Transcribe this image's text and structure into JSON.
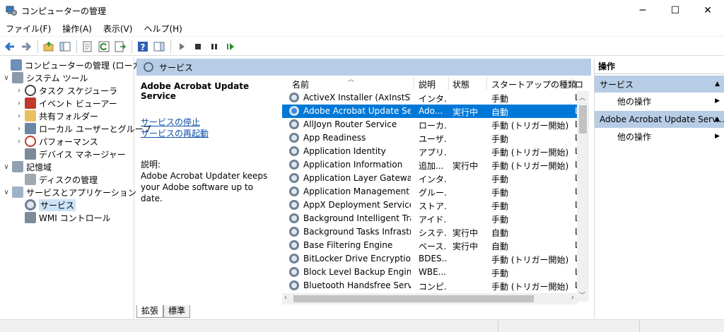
{
  "window": {
    "title": "コンピューターの管理",
    "minimize": "─",
    "maximize": "☐",
    "close": "✕"
  },
  "menu": [
    "ファイル(F)",
    "操作(A)",
    "表示(V)",
    "ヘルプ(H)"
  ],
  "toolbar": {
    "icons": [
      "back-icon",
      "forward-icon",
      "up-folder-icon",
      "show-hide-tree-icon",
      "properties-icon",
      "refresh-icon",
      "export-list-icon",
      "help-icon",
      "show-hide-action-pane-icon",
      "start-service-icon",
      "stop-service-icon",
      "pause-service-icon",
      "restart-service-icon"
    ]
  },
  "tree": [
    {
      "label": "コンピューターの管理 (ローカル)",
      "chevron": ""
    },
    {
      "label": "システム ツール",
      "chevron": "∨"
    },
    {
      "label": "タスク スケジューラ",
      "chevron": "›"
    },
    {
      "label": "イベント ビューアー",
      "chevron": "›"
    },
    {
      "label": "共有フォルダー",
      "chevron": "›"
    },
    {
      "label": "ローカル ユーザーとグループ",
      "chevron": "›"
    },
    {
      "label": "パフォーマンス",
      "chevron": "›"
    },
    {
      "label": "デバイス マネージャー",
      "chevron": ""
    },
    {
      "label": "記憶域",
      "chevron": "∨"
    },
    {
      "label": "ディスクの管理",
      "chevron": ""
    },
    {
      "label": "サービスとアプリケーション",
      "chevron": "∨"
    },
    {
      "label": "サービス",
      "chevron": ""
    },
    {
      "label": "WMI コントロール",
      "chevron": ""
    }
  ],
  "services_pane": {
    "header": "サービス",
    "detail": {
      "name": "Adobe Acrobat Update Service",
      "stop_link": "サービスの停止",
      "restart_link": "サービスの再起動",
      "desc_label": "説明:",
      "desc": "Adobe Acrobat Updater keeps your Adobe software up to date."
    },
    "columns": {
      "name": "名前",
      "desc": "説明",
      "status": "状態",
      "startup": "スタートアップの種類",
      "logon": "ロ"
    },
    "rows": [
      {
        "name": "ActiveX Installer (AxInstSV)",
        "desc": "インタ...",
        "status": "",
        "startup": "手動",
        "logon": "L"
      },
      {
        "name": "Adobe Acrobat Update Serv...",
        "desc": "Ado...",
        "status": "実行中",
        "startup": "自動",
        "logon": "L"
      },
      {
        "name": "AllJoyn Router Service",
        "desc": "ローカ...",
        "status": "",
        "startup": "手動 (トリガー開始)",
        "logon": "L"
      },
      {
        "name": "App Readiness",
        "desc": "ユーザ...",
        "status": "",
        "startup": "手動",
        "logon": "L"
      },
      {
        "name": "Application Identity",
        "desc": "アプリ...",
        "status": "",
        "startup": "手動 (トリガー開始)",
        "logon": "L"
      },
      {
        "name": "Application Information",
        "desc": "追加...",
        "status": "実行中",
        "startup": "手動 (トリガー開始)",
        "logon": "L"
      },
      {
        "name": "Application Layer Gateway ...",
        "desc": "インタ...",
        "status": "",
        "startup": "手動",
        "logon": "L"
      },
      {
        "name": "Application Management",
        "desc": "グルー...",
        "status": "",
        "startup": "手動",
        "logon": "L"
      },
      {
        "name": "AppX Deployment Service (...",
        "desc": "ストア...",
        "status": "",
        "startup": "手動",
        "logon": "L"
      },
      {
        "name": "Background Intelligent Tran...",
        "desc": "アイド...",
        "status": "",
        "startup": "手動",
        "logon": "L"
      },
      {
        "name": "Background Tasks Infrastruc...",
        "desc": "システ...",
        "status": "実行中",
        "startup": "自動",
        "logon": "L"
      },
      {
        "name": "Base Filtering Engine",
        "desc": "ベース...",
        "status": "実行中",
        "startup": "自動",
        "logon": "L"
      },
      {
        "name": "BitLocker Drive Encryption ...",
        "desc": "BDES...",
        "status": "",
        "startup": "手動 (トリガー開始)",
        "logon": "L"
      },
      {
        "name": "Block Level Backup Engine ...",
        "desc": "WBE...",
        "status": "",
        "startup": "手動",
        "logon": "L"
      },
      {
        "name": "Bluetooth Handsfree Service",
        "desc": "コンピ...",
        "status": "",
        "startup": "手動 (トリガー開始)",
        "logon": "L"
      }
    ],
    "tabs": [
      "拡張",
      "標準"
    ]
  },
  "actions": {
    "title": "操作",
    "sections": [
      {
        "header": "サービス",
        "item": "他の操作"
      },
      {
        "header": "Adobe Acrobat Update Serv...",
        "item": "他の操作"
      }
    ]
  }
}
